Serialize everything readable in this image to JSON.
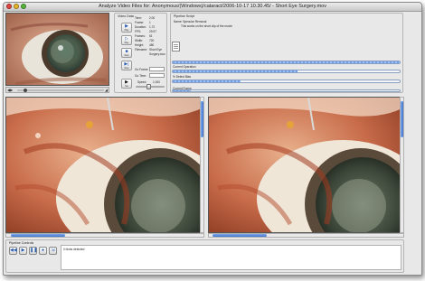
{
  "window": {
    "title": "Analyze Video Files for: Anonymous/(Windows)/cataract/2006-10-17 10.30.45/ - Short Eye Surgery.mov"
  },
  "video_data": {
    "header": "Video Data",
    "stats": [
      {
        "label": "Time:",
        "value": "2.00"
      },
      {
        "label": "Frame:",
        "value": "1"
      },
      {
        "label": "Duration:",
        "value": "1.72"
      },
      {
        "label": "FPS:",
        "value": "29.97"
      },
      {
        "label": "Frames:",
        "value": "51"
      },
      {
        "label": "Width:",
        "value": "720"
      },
      {
        "label": "Height:",
        "value": "480"
      },
      {
        "label": "Filename:",
        "value": "Short Eye Surgery.mov"
      }
    ],
    "buttons": [
      {
        "label": "Play",
        "icon": "play-icon"
      },
      {
        "label": "Play",
        "icon": "play-icon"
      },
      {
        "label": "Stop",
        "icon": "stop-icon"
      },
      {
        "label": "Step",
        "icon": "step-icon"
      },
      {
        "label": "Set",
        "icon": "set-icon"
      }
    ],
    "go_frame_label": "Go Frame:",
    "go_time_label": "Go Time:",
    "speed_label": "Speed:",
    "speed_value": "1.000"
  },
  "pipeline_script": {
    "header": "Pipeline Script",
    "name_line": "Name: Specular Removal",
    "description": "This works on the short clip of the movie",
    "progress_labels": [
      "Current Operation",
      "% Detect Bias",
      "Current Frame"
    ],
    "progress_values": [
      1.0,
      0.55,
      0.3,
      0.08
    ]
  },
  "pipeline_controls": {
    "header": "Pipeline Controls",
    "status": "0 blobs detected",
    "buttons": [
      "rewind-icon",
      "play-icon",
      "pause-icon",
      "record-icon",
      "export-icon"
    ]
  },
  "player": {
    "position": 0.08
  },
  "colors": {
    "accent": "#3f73cf",
    "progress_fill": "#6f9ee8"
  }
}
